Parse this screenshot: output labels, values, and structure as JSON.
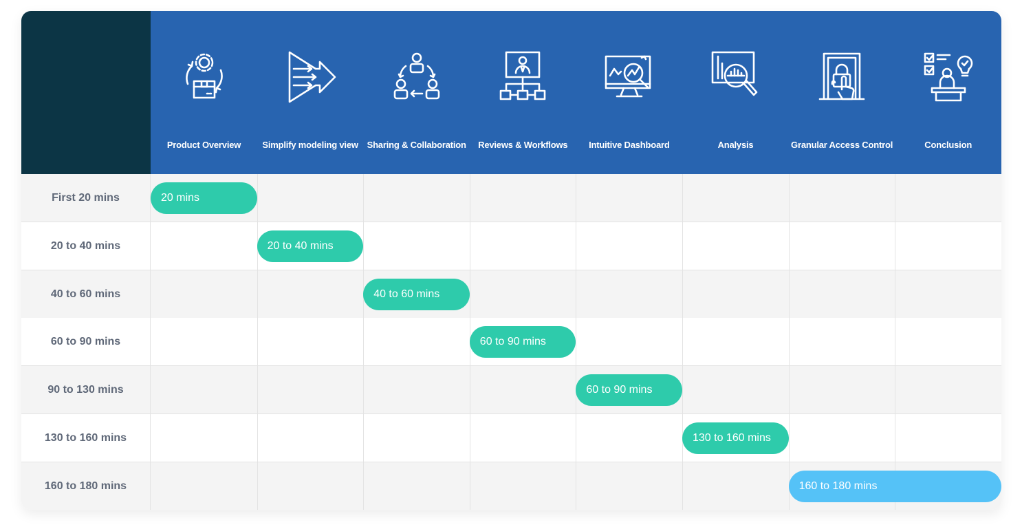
{
  "columns": [
    {
      "label": "Product Overview",
      "icon": "product-overview-icon"
    },
    {
      "label": "Simplify modeling view",
      "icon": "simplify-modeling-icon"
    },
    {
      "label": "Sharing & Collaboration",
      "icon": "collaboration-icon"
    },
    {
      "label": "Reviews & Workflows",
      "icon": "workflow-icon"
    },
    {
      "label": "Intuitive Dashboard",
      "icon": "dashboard-icon"
    },
    {
      "label": "Analysis",
      "icon": "analysis-icon"
    },
    {
      "label": "Granular Access Control",
      "icon": "access-control-icon"
    },
    {
      "label": "Conclusion",
      "icon": "conclusion-icon"
    }
  ],
  "rows": [
    {
      "label": "First 20 mins",
      "bar": "20 mins",
      "col": 0,
      "span": 1,
      "color": "#2ecbab"
    },
    {
      "label": "20 to 40 mins",
      "bar": "20 to 40 mins",
      "col": 1,
      "span": 1,
      "color": "#2ecbab"
    },
    {
      "label": "40 to 60 mins",
      "bar": "40 to 60 mins",
      "col": 2,
      "span": 1,
      "color": "#2ecbab"
    },
    {
      "label": "60 to 90 mins",
      "bar": "60 to 90 mins",
      "col": 3,
      "span": 1,
      "color": "#2ecbab"
    },
    {
      "label": "90 to 130 mins",
      "bar": "60 to 90 mins",
      "col": 4,
      "span": 1,
      "color": "#2ecbab"
    },
    {
      "label": "130 to 160 mins",
      "bar": "130 to 160 mins",
      "col": 5,
      "span": 1,
      "color": "#2ecbab"
    },
    {
      "label": "160 to 180 mins",
      "bar": "160 to 180 mins",
      "col": 6,
      "span": 2,
      "color": "#55c2f7"
    }
  ],
  "colors": {
    "header_bg": "#2864b0",
    "corner_bg": "#0c3545",
    "pill_green": "#2ecbab",
    "pill_blue": "#55c2f7",
    "row_label": "#5f6878"
  }
}
